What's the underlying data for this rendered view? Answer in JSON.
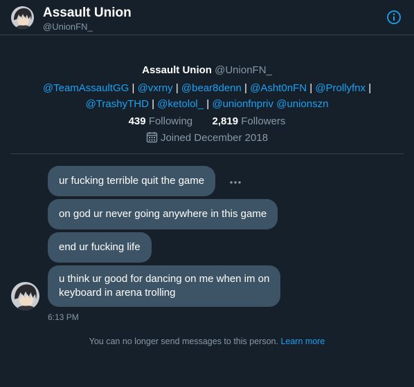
{
  "header": {
    "title": "Assault Union",
    "handle": "@UnionFN_",
    "info_icon": "info-icon"
  },
  "profile": {
    "name": "Assault Union",
    "handle": "@UnionFN_",
    "bio_links": {
      "l1": "@TeamAssaultGG",
      "l2": "@vxrny",
      "l3": "@bear8denn",
      "l4": "@Asht0nFN",
      "l5": "@Prollyfnx",
      "l6": "@TrashyTHD",
      "l7": "@ketolol_",
      "l8": "@unionfnpriv",
      "l9": "@unionszn"
    },
    "separator": "|",
    "following_count": "439",
    "following_label": "Following",
    "followers_count": "2,819",
    "followers_label": "Followers",
    "joined": "Joined December 2018",
    "calendar_icon": "calendar-icon"
  },
  "messages": [
    {
      "text": "ur fucking terrible quit the game"
    },
    {
      "text": "on god ur never going anywhere in this game"
    },
    {
      "text": "end ur fucking life"
    },
    {
      "line1": "u think ur good for dancing on me when im on",
      "line2": "keyboard in arena trolling"
    }
  ],
  "timestamp": "6:13 PM",
  "notice": {
    "text": "You can no longer send messages to this person.",
    "link": "Learn more"
  },
  "colors": {
    "background": "#15202b",
    "bubble": "#3d5466",
    "accent": "#1da1f2",
    "muted": "#8899a6",
    "divider": "#38444d"
  }
}
